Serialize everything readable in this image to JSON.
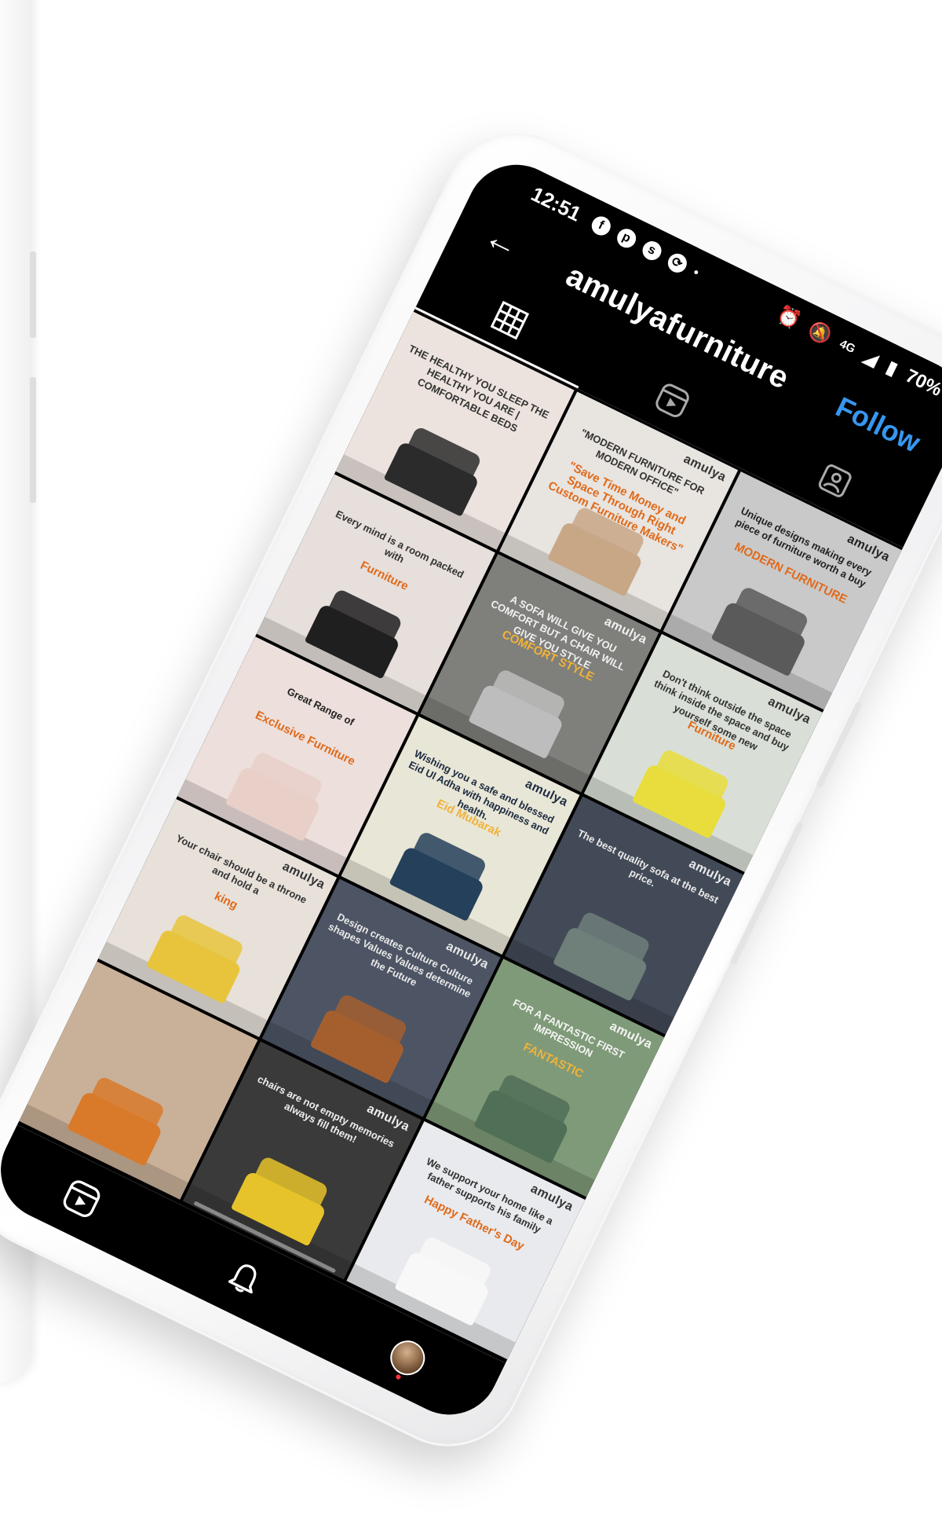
{
  "status_bar": {
    "time": "12:51",
    "notifications": [
      "facebook-icon",
      "pinterest-icon",
      "skype-icon",
      "sync-icon"
    ],
    "network": "4G",
    "battery": "70%"
  },
  "header": {
    "back_icon": "arrow-left-icon",
    "username": "amulyafurniture",
    "follow_label": "Follow",
    "follow_color": "#3797f0"
  },
  "tabs": [
    {
      "icon": "grid-icon",
      "active": true
    },
    {
      "icon": "reels-icon",
      "active": false
    },
    {
      "icon": "tagged-icon",
      "active": false
    }
  ],
  "posts": [
    {
      "brand": "",
      "text": "THE HEALTHY YOU SLEEP THE HEALTHY YOU ARE | COMFORTABLE BEDS",
      "accent": "",
      "bg": "#ece3de",
      "furn": "#2b2b2b",
      "text_color": "#333"
    },
    {
      "brand": "amulya",
      "text": "\"MODERN FURNITURE FOR MODERN OFFICE\"",
      "accent": "\"Save Time Money and Space Through Right Custom Furniture Makers\"",
      "bg": "#e8e4df",
      "furn": "#c8a787",
      "text_color": "#333"
    },
    {
      "brand": "amulya",
      "text": "Unique designs making every piece of furniture worth a buy",
      "accent": "MODERN FURNITURE",
      "bg": "#c9c9c9",
      "furn": "#5a5a5a",
      "text_color": "#222"
    },
    {
      "brand": "",
      "text": "Every mind is a room packed with",
      "accent": "Furniture",
      "bg": "#e6dfdb",
      "furn": "#1f1f1f",
      "text_color": "#333"
    },
    {
      "brand": "amulya",
      "text": "A SOFA WILL GIVE YOU COMFORT BUT A CHAIR WILL GIVE YOU STYLE",
      "accent": "COMFORT STYLE",
      "bg": "#7f7f7c",
      "furn": "#bdbdbd",
      "text_color": "#f1f1f1"
    },
    {
      "brand": "amulya",
      "text": "Don't think outside the space think inside the space and buy yourself some new",
      "accent": "Furniture",
      "bg": "#d9dfd6",
      "furn": "#e8dd3c",
      "text_color": "#333"
    },
    {
      "brand": "",
      "text": "Great Range of",
      "accent": "Exclusive Furniture",
      "bg": "#eddfdc",
      "furn": "#e8d0c8",
      "text_color": "#222"
    },
    {
      "brand": "amulya",
      "text": "Wishing you a safe and blessed Eid Ul Adha with happiness and health.",
      "accent": "Eid Mubarak",
      "bg": "#e8e6d6",
      "furn": "#25405a",
      "text_color": "#1d2b40"
    },
    {
      "brand": "amulya",
      "text": "The best quality sofa at the best price.",
      "accent": "",
      "bg": "#434a57",
      "furn": "#6f7f7a",
      "text_color": "#eaeaea"
    },
    {
      "brand": "amulya",
      "text": "Your chair should be a throne and hold a",
      "accent": "king",
      "bg": "#e7e1da",
      "furn": "#e8c43c",
      "text_color": "#333"
    },
    {
      "brand": "amulya",
      "text": "Design creates Culture Culture shapes Values Values determine the Future",
      "accent": "",
      "bg": "#4d5565",
      "furn": "#a55f2e",
      "text_color": "#e8e8e8"
    },
    {
      "brand": "amulya",
      "text": "FOR A FANTASTIC FIRST IMPRESSION",
      "accent": "FANTASTIC",
      "bg": "#7f9a78",
      "furn": "#4f6f57",
      "text_color": "#f4f4f4"
    },
    {
      "brand": "",
      "text": "",
      "accent": "",
      "bg": "#c9b199",
      "furn": "#d97a2a",
      "text_color": "#333"
    },
    {
      "brand": "amulya",
      "text": "chairs are not empty memories always fill them!",
      "accent": "",
      "bg": "#3a3a3a",
      "furn": "#e6c32a",
      "text_color": "#eeeeee"
    },
    {
      "brand": "amulya",
      "text": "We support your home like a father supports his family",
      "accent": "Happy Father's Day",
      "bg": "#e9eaed",
      "furn": "#f8f8f8",
      "text_color": "#333"
    }
  ],
  "bottom_nav": [
    "reels-icon",
    "notifications-icon",
    "profile-avatar"
  ]
}
